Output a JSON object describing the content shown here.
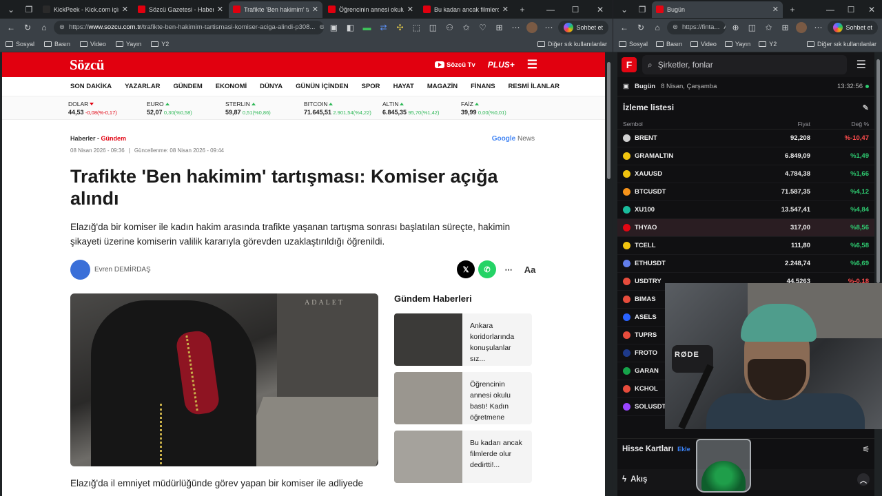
{
  "left_window": {
    "tabs": [
      {
        "title": "KickPeek - Kick.com için Gel",
        "fav": "#2a2a2a",
        "active": false
      },
      {
        "title": "Sözcü Gazetesi - Haberler, so",
        "fav": "#e1000f",
        "active": false
      },
      {
        "title": "Trafikte 'Ben hakimim' tartış",
        "fav": "#e1000f",
        "active": true
      },
      {
        "title": "Öğrencinin annesi okulu bas",
        "fav": "#e1000f",
        "active": false
      },
      {
        "title": "Bu kadarı ancak filmlerde ol",
        "fav": "#e1000f",
        "active": false
      }
    ],
    "url_prefix": "https://",
    "url_host": "www.sozcu.com.tr",
    "url_path": "/trafikte-ben-hakimim-tartismasi-komiser-aciga-alindi-p308...",
    "copilot_label": "Sohbet et",
    "bookmarks": [
      "Sosyal",
      "Basın",
      "Video",
      "Yayın",
      "Y2"
    ],
    "bookmarks_other": "Diğer sık kullanılanlar"
  },
  "site": {
    "logo": "Sözcü",
    "tv": "Sözcü Tv",
    "plus": "PLUS+",
    "nav": [
      "SON DAKİKA",
      "YAZARLAR",
      "GÜNDEM",
      "EKONOMİ",
      "DÜNYA",
      "GÜNÜN İÇİNDEN",
      "SPOR",
      "HAYAT",
      "MAGAZİN",
      "FİNANS",
      "RESMİ İLANLAR"
    ],
    "market": [
      {
        "name": "DOLAR",
        "value": "44,53",
        "change": "-0,08(%-0,17)",
        "dir": "down"
      },
      {
        "name": "EURO",
        "value": "52,07",
        "change": "0,30(%0,58)",
        "dir": "up"
      },
      {
        "name": "STERLIN",
        "value": "59,87",
        "change": "0,51(%0,86)",
        "dir": "up"
      },
      {
        "name": "BITCOIN",
        "value": "71.645,51",
        "change": "2.901,54(%4,22)",
        "dir": "up"
      },
      {
        "name": "ALTIN",
        "value": "6.845,35",
        "change": "95,70(%1,42)",
        "dir": "up"
      },
      {
        "name": "FAİZ",
        "value": "39,99",
        "change": "0,00(%0,01)",
        "dir": "up"
      }
    ]
  },
  "article": {
    "crumb_a": "Haberler",
    "crumb_sep": " - ",
    "crumb_b": "Gündem",
    "google_news_g": "Google",
    "google_news_n": " News",
    "published": "08 Nisan 2026 - 09:36",
    "updated": "Güncellenme: 08 Nisan 2026 - 09:44",
    "title": "Trafikte 'Ben hakimim' tartışması: Komiser açığa alındı",
    "lead": "Elazığ'da bir komiser ile kadın hakim arasında trafikte yaşanan tartışma sonrası başlatılan süreçte, hakimin şikayeti üzerine komiserin valilik kararıyla görevden uzaklaştırıldığı öğrenildi.",
    "author": "Evren DEMİRDAŞ",
    "photo_sign": "ADALET",
    "body_start": "Elazığ'da il emniyet müdürlüğünde görev yapan bir komiser ile adliyede",
    "text_size_label": "Aa"
  },
  "sidebar": {
    "heading": "Gündem Haberleri",
    "items": [
      {
        "text": "Ankara koridorlarında konuşulanlar sız...",
        "bg": "#3b3a38"
      },
      {
        "text": "Öğrencinin annesi okulu bastı! Kadın öğretmene ders...",
        "bg": "#9a968f"
      },
      {
        "text": "Bu kadarı ancak filmlerde olur dedirtti!...",
        "bg": "#a5a29c"
      }
    ]
  },
  "right_window": {
    "tab_title": "Bugün",
    "url": "https://finta...",
    "copilot_label": "Sohbet et",
    "bookmarks": [
      "Sosyal",
      "Basın",
      "Video",
      "Yayın",
      "Y2"
    ],
    "bookmarks_other": "Diğer sık kullanılanlar"
  },
  "fintables": {
    "logo": "F",
    "search_placeholder": "Şirketler, fonlar",
    "today_label": "Bugün",
    "date": "8 Nisan, Çarşamba",
    "time": "13:32:56",
    "watchlist_title": "İzleme listesi",
    "cols": {
      "symbol": "Sembol",
      "price": "Fiyat",
      "change": "Değ %"
    },
    "rows": [
      {
        "sym": "BRENT",
        "price": "92,208",
        "change": "%-10,47",
        "dir": "neg",
        "icon": "#d0d0d0"
      },
      {
        "sym": "GRAMALTIN",
        "price": "6.849,09",
        "change": "%1,49",
        "dir": "pos",
        "icon": "#f1c40f"
      },
      {
        "sym": "XAUUSD",
        "price": "4.784,38",
        "change": "%1,66",
        "dir": "pos",
        "icon": "#f1c40f"
      },
      {
        "sym": "BTCUSDT",
        "price": "71.587,35",
        "change": "%4,12",
        "dir": "pos",
        "icon": "#f7931a"
      },
      {
        "sym": "XU100",
        "price": "13.547,41",
        "change": "%4,84",
        "dir": "pos",
        "icon": "#1abc9c"
      },
      {
        "sym": "THYAO",
        "price": "317,00",
        "change": "%8,56",
        "dir": "pos",
        "icon": "#e30613"
      },
      {
        "sym": "TCELL",
        "price": "111,80",
        "change": "%6,58",
        "dir": "pos",
        "icon": "#f1c40f"
      },
      {
        "sym": "ETHUSDT",
        "price": "2.248,74",
        "change": "%6,69",
        "dir": "pos",
        "icon": "#627eea"
      },
      {
        "sym": "USDTRY",
        "price": "44,5263",
        "change": "%-0,18",
        "dir": "neg",
        "icon": "#e74c3c"
      },
      {
        "sym": "BIMAS",
        "price": "",
        "change": "",
        "dir": "pos",
        "icon": "#e74c3c"
      },
      {
        "sym": "ASELS",
        "price": "",
        "change": "",
        "dir": "pos",
        "icon": "#2962ff"
      },
      {
        "sym": "TUPRS",
        "price": "",
        "change": "",
        "dir": "pos",
        "icon": "#e74c3c"
      },
      {
        "sym": "FROTO",
        "price": "",
        "change": "",
        "dir": "pos",
        "icon": "#1e3a8a"
      },
      {
        "sym": "GARAN",
        "price": "",
        "change": "",
        "dir": "pos",
        "icon": "#16a34a"
      },
      {
        "sym": "KCHOL",
        "price": "",
        "change": "",
        "dir": "pos",
        "icon": "#e74c3c"
      },
      {
        "sym": "SOLUSDT",
        "price": "",
        "change": "",
        "dir": "pos",
        "icon": "#9945ff"
      }
    ],
    "cards_title": "Hisse Kartları",
    "cards_add": "Ekle",
    "flow_title": "Akış"
  },
  "overlay": {
    "mic_brand": "RØDE"
  }
}
